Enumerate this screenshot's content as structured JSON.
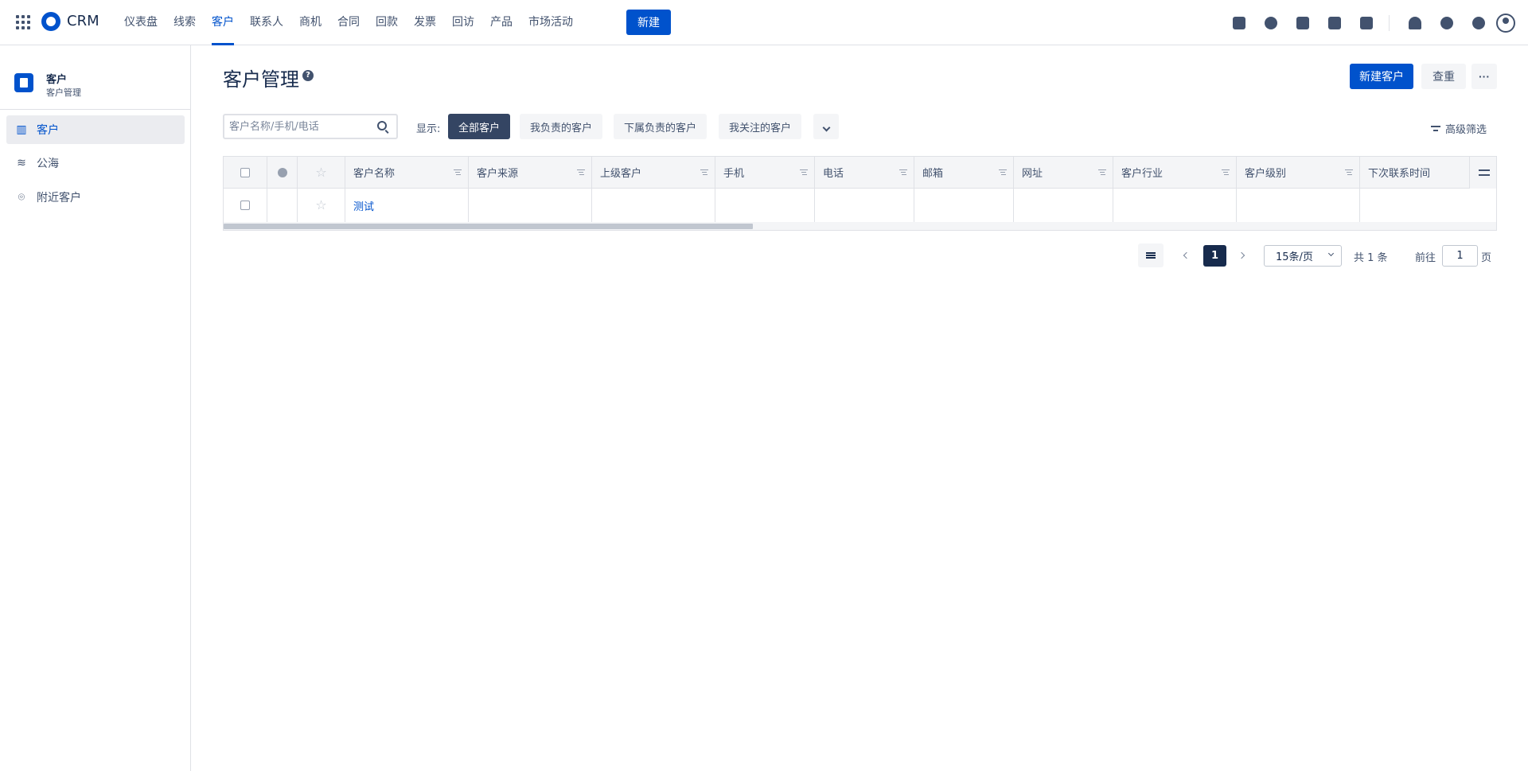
{
  "app": {
    "brand": "CRM",
    "new_button": "新建",
    "nav": [
      {
        "label": "仪表盘",
        "active": false
      },
      {
        "label": "线索",
        "active": false
      },
      {
        "label": "客户",
        "active": true
      },
      {
        "label": "联系人",
        "active": false
      },
      {
        "label": "商机",
        "active": false
      },
      {
        "label": "合同",
        "active": false
      },
      {
        "label": "回款",
        "active": false
      },
      {
        "label": "发票",
        "active": false
      },
      {
        "label": "回访",
        "active": false
      },
      {
        "label": "产品",
        "active": false
      },
      {
        "label": "市场活动",
        "active": false
      }
    ],
    "top_icons": [
      "task-icon",
      "contact-icon",
      "note-icon",
      "phone-icon",
      "calendar-icon",
      "bell-icon",
      "help-icon",
      "settings-icon",
      "avatar-icon"
    ]
  },
  "sidebar": {
    "title": "客户",
    "subtitle": "客户管理",
    "items": [
      {
        "label": "客户",
        "icon": "building-icon",
        "active": true
      },
      {
        "label": "公海",
        "icon": "waves-icon",
        "active": false
      },
      {
        "label": "附近客户",
        "icon": "location-pin-icon",
        "active": false
      }
    ]
  },
  "main": {
    "title": "客户管理",
    "help": "?",
    "new_customer": "新建客户",
    "recheck": "查重",
    "more": "···",
    "search_placeholder": "客户名称/手机/电话",
    "show_label": "显示:",
    "filters": [
      {
        "label": "全部客户",
        "active": true
      },
      {
        "label": "我负责的客户",
        "active": false
      },
      {
        "label": "下属负责的客户",
        "active": false
      },
      {
        "label": "我关注的客户",
        "active": false
      }
    ],
    "advanced_filter": "高级筛选"
  },
  "table": {
    "columns": [
      "客户名称",
      "客户来源",
      "上级客户",
      "手机",
      "电话",
      "邮箱",
      "网址",
      "客户行业",
      "客户级别",
      "下次联系时间"
    ],
    "rows": [
      {
        "name": "测试",
        "source": "",
        "parent": "",
        "mobile": "",
        "phone": "",
        "email": "",
        "website": "",
        "industry": "",
        "level": "",
        "next_contact": ""
      }
    ]
  },
  "pagination": {
    "current": "1",
    "page_size": "15条/页",
    "total": "共 1 条",
    "goto_label": "前往",
    "goto_value": "1",
    "goto_suffix": "页"
  },
  "colors": {
    "primary": "#0052cc",
    "active_filter": "#344563",
    "text": "#172b4d"
  }
}
